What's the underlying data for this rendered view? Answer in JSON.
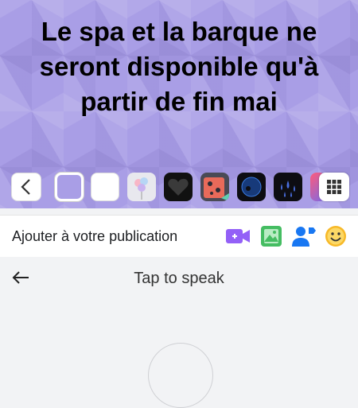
{
  "post": {
    "text": "Le spa et la barque ne seront disponible qu'à partir de fin mai",
    "background_color": "#a99ee6"
  },
  "background_picker": {
    "back_icon": "chevron-left-icon",
    "swatches": [
      {
        "name": "purple-cubes",
        "selected": true
      },
      {
        "name": "white"
      },
      {
        "name": "balloons"
      },
      {
        "name": "heart"
      },
      {
        "name": "red-pattern"
      },
      {
        "name": "dark-globe"
      },
      {
        "name": "drops"
      },
      {
        "name": "gradient"
      }
    ],
    "more_icon": "grid-icon"
  },
  "add_bar": {
    "label": "Ajouter à votre publication",
    "icons": [
      "video-camera-icon",
      "photo-icon",
      "tag-people-icon",
      "smiley-icon"
    ]
  },
  "speech": {
    "title": "Tap to speak",
    "back_icon": "arrow-left-icon"
  }
}
